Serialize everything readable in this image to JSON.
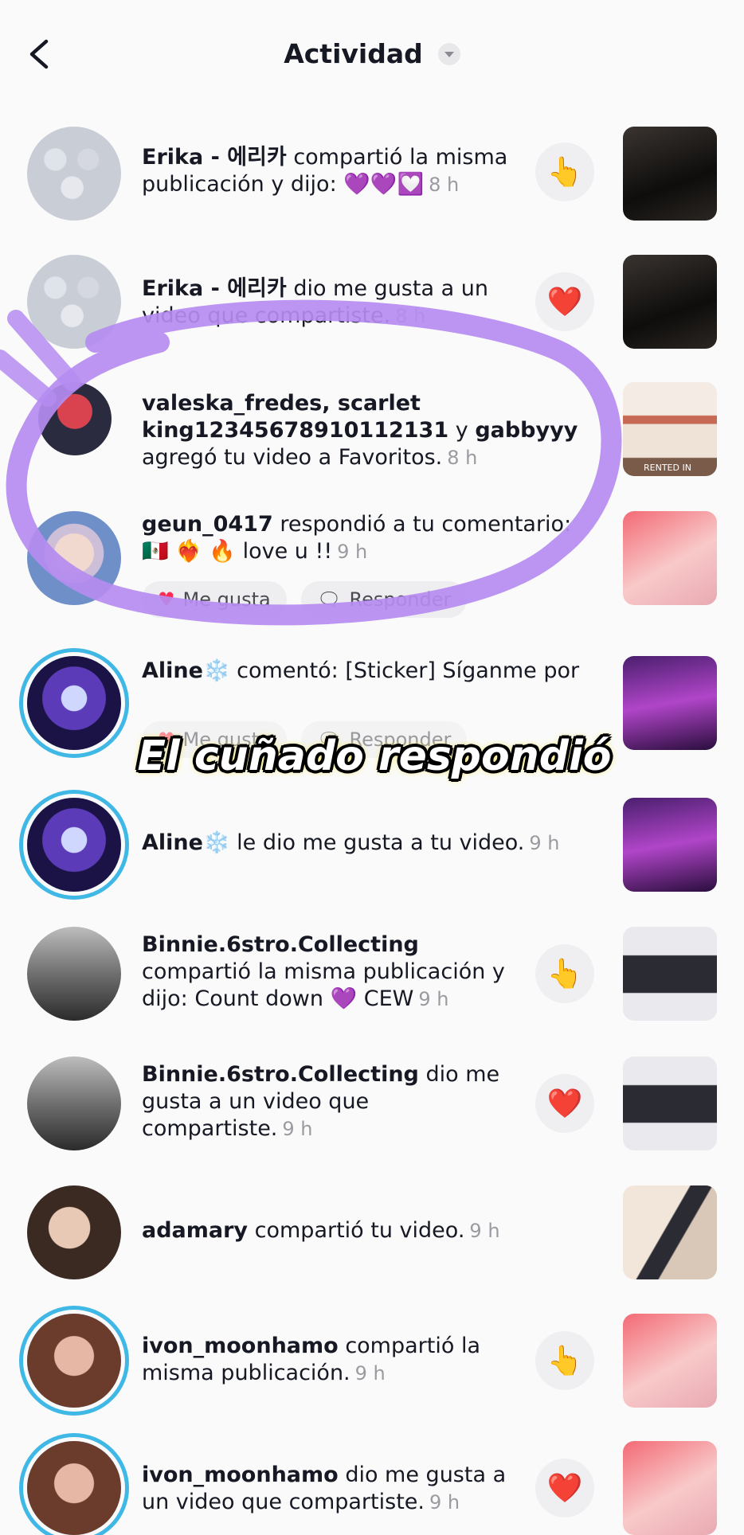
{
  "header": {
    "title": "Actividad"
  },
  "rows": [
    {
      "name": "Erika - 에리카",
      "action": "compartió la misma publicación y dijo:",
      "extra": "💜💜💟",
      "time": "8 h",
      "reaction": "👆"
    },
    {
      "name": "Erika - 에리카",
      "action": "dio me gusta a un video que compartiste.",
      "time": "8 h",
      "reaction": "❤️"
    },
    {
      "name": "valeska_fredes, scarlet king12345678910112131",
      "mid": "y",
      "name2": "gabbyyy",
      "action": "agregó tu video a Favoritos.",
      "time": "8 h",
      "thumb_text": "RENTED IN"
    },
    {
      "name": "geun_0417",
      "action": "respondió a tu comentario:",
      "extra": "🇲🇽 ❤️‍🔥 🔥 love u !!",
      "time": "9 h",
      "like_label": "Me gusta",
      "reply_label": "Responder"
    },
    {
      "name": "Aline❄️",
      "action": "comentó: [Sticker] Síganme por",
      "like_label": "Me gusta",
      "reply_label": "Responder"
    },
    {
      "name": "Aline❄️",
      "action": "le dio me gusta a tu video.",
      "time": "9 h"
    },
    {
      "name": "Binnie.6stro.Collecting",
      "action": "compartió la misma publicación y dijo: Count down 💜 CEW",
      "time": "9 h",
      "reaction": "👆"
    },
    {
      "name": "Binnie.6stro.Collecting",
      "action": "dio me gusta a un video que compartiste.",
      "time": "9 h",
      "reaction": "❤️"
    },
    {
      "name": "adamary",
      "action": "compartió tu video.",
      "time": "9 h"
    },
    {
      "name": "ivon_moonhamo",
      "action": "compartió la misma publicación.",
      "time": "9 h",
      "reaction": "👆"
    },
    {
      "name": "ivon_moonhamo",
      "action": "dio me gusta a un video que compartiste.",
      "time": "9 h",
      "reaction": "❤️"
    }
  ],
  "caption": "El cuñado respondió",
  "colors": {
    "accent": "#3fb8e6",
    "highlight": "#b58cf0",
    "like": "#fe2c55"
  }
}
